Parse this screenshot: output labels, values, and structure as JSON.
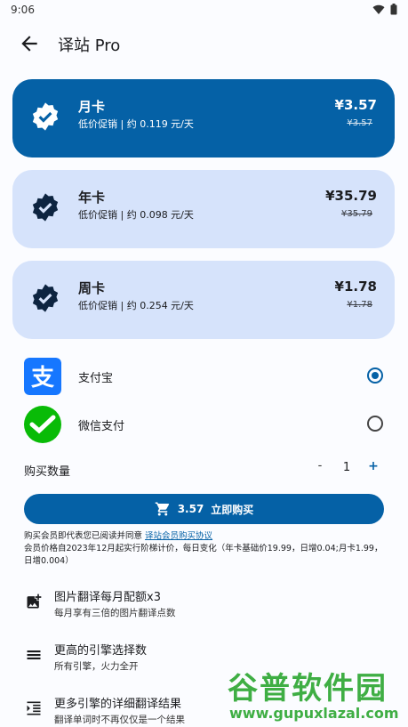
{
  "status": {
    "time": "9:06"
  },
  "appbar": {
    "title": "译站 Pro"
  },
  "plans": [
    {
      "name": "月卡",
      "desc": "低价促销 | 约 0.119 元/天",
      "price": "¥3.57",
      "old_price": "¥3.57",
      "selected": true
    },
    {
      "name": "年卡",
      "desc": "低价促销 | 约 0.098 元/天",
      "price": "¥35.79",
      "old_price": "¥35.79",
      "selected": false
    },
    {
      "name": "周卡",
      "desc": "低价促销 | 约 0.254 元/天",
      "price": "¥1.78",
      "old_price": "¥1.78",
      "selected": false
    }
  ],
  "payment": [
    {
      "label": "支付宝",
      "icon": "alipay-logo",
      "selected": true
    },
    {
      "label": "微信支付",
      "icon": "wechat-pay-logo",
      "selected": false
    }
  ],
  "quantity": {
    "label": "购买数量",
    "minus": "-",
    "value": "1",
    "plus": "+"
  },
  "buy": {
    "amount": "3.57",
    "label": "立即购买"
  },
  "notice": {
    "prefix": "购买会员即代表您已阅读并同意",
    "link": "译站会员购买协议",
    "detail": "会员价格自2023年12月起实行阶梯计价，每日变化（年卡基础价19.99，日增0.04;月卡1.99，日增0.004）"
  },
  "features": [
    {
      "title": "图片翻译每月配额x3",
      "sub": "每月享有三倍的图片翻译点数",
      "icon": "add-photo-icon"
    },
    {
      "title": "更高的引擎选择数",
      "sub": "所有引擎，火力全开",
      "icon": "menu-icon"
    },
    {
      "title": "更多引擎的详细翻译结果",
      "sub": "翻译单词时不再仅仅是一个结果",
      "icon": "format-indent-icon"
    }
  ],
  "watermark": {
    "cn": "谷普软件园",
    "url": "www.gupuxlazal.com"
  },
  "colors": {
    "primary": "#0561a6",
    "card": "#d6e3fb",
    "watermark": "#3fae44"
  }
}
